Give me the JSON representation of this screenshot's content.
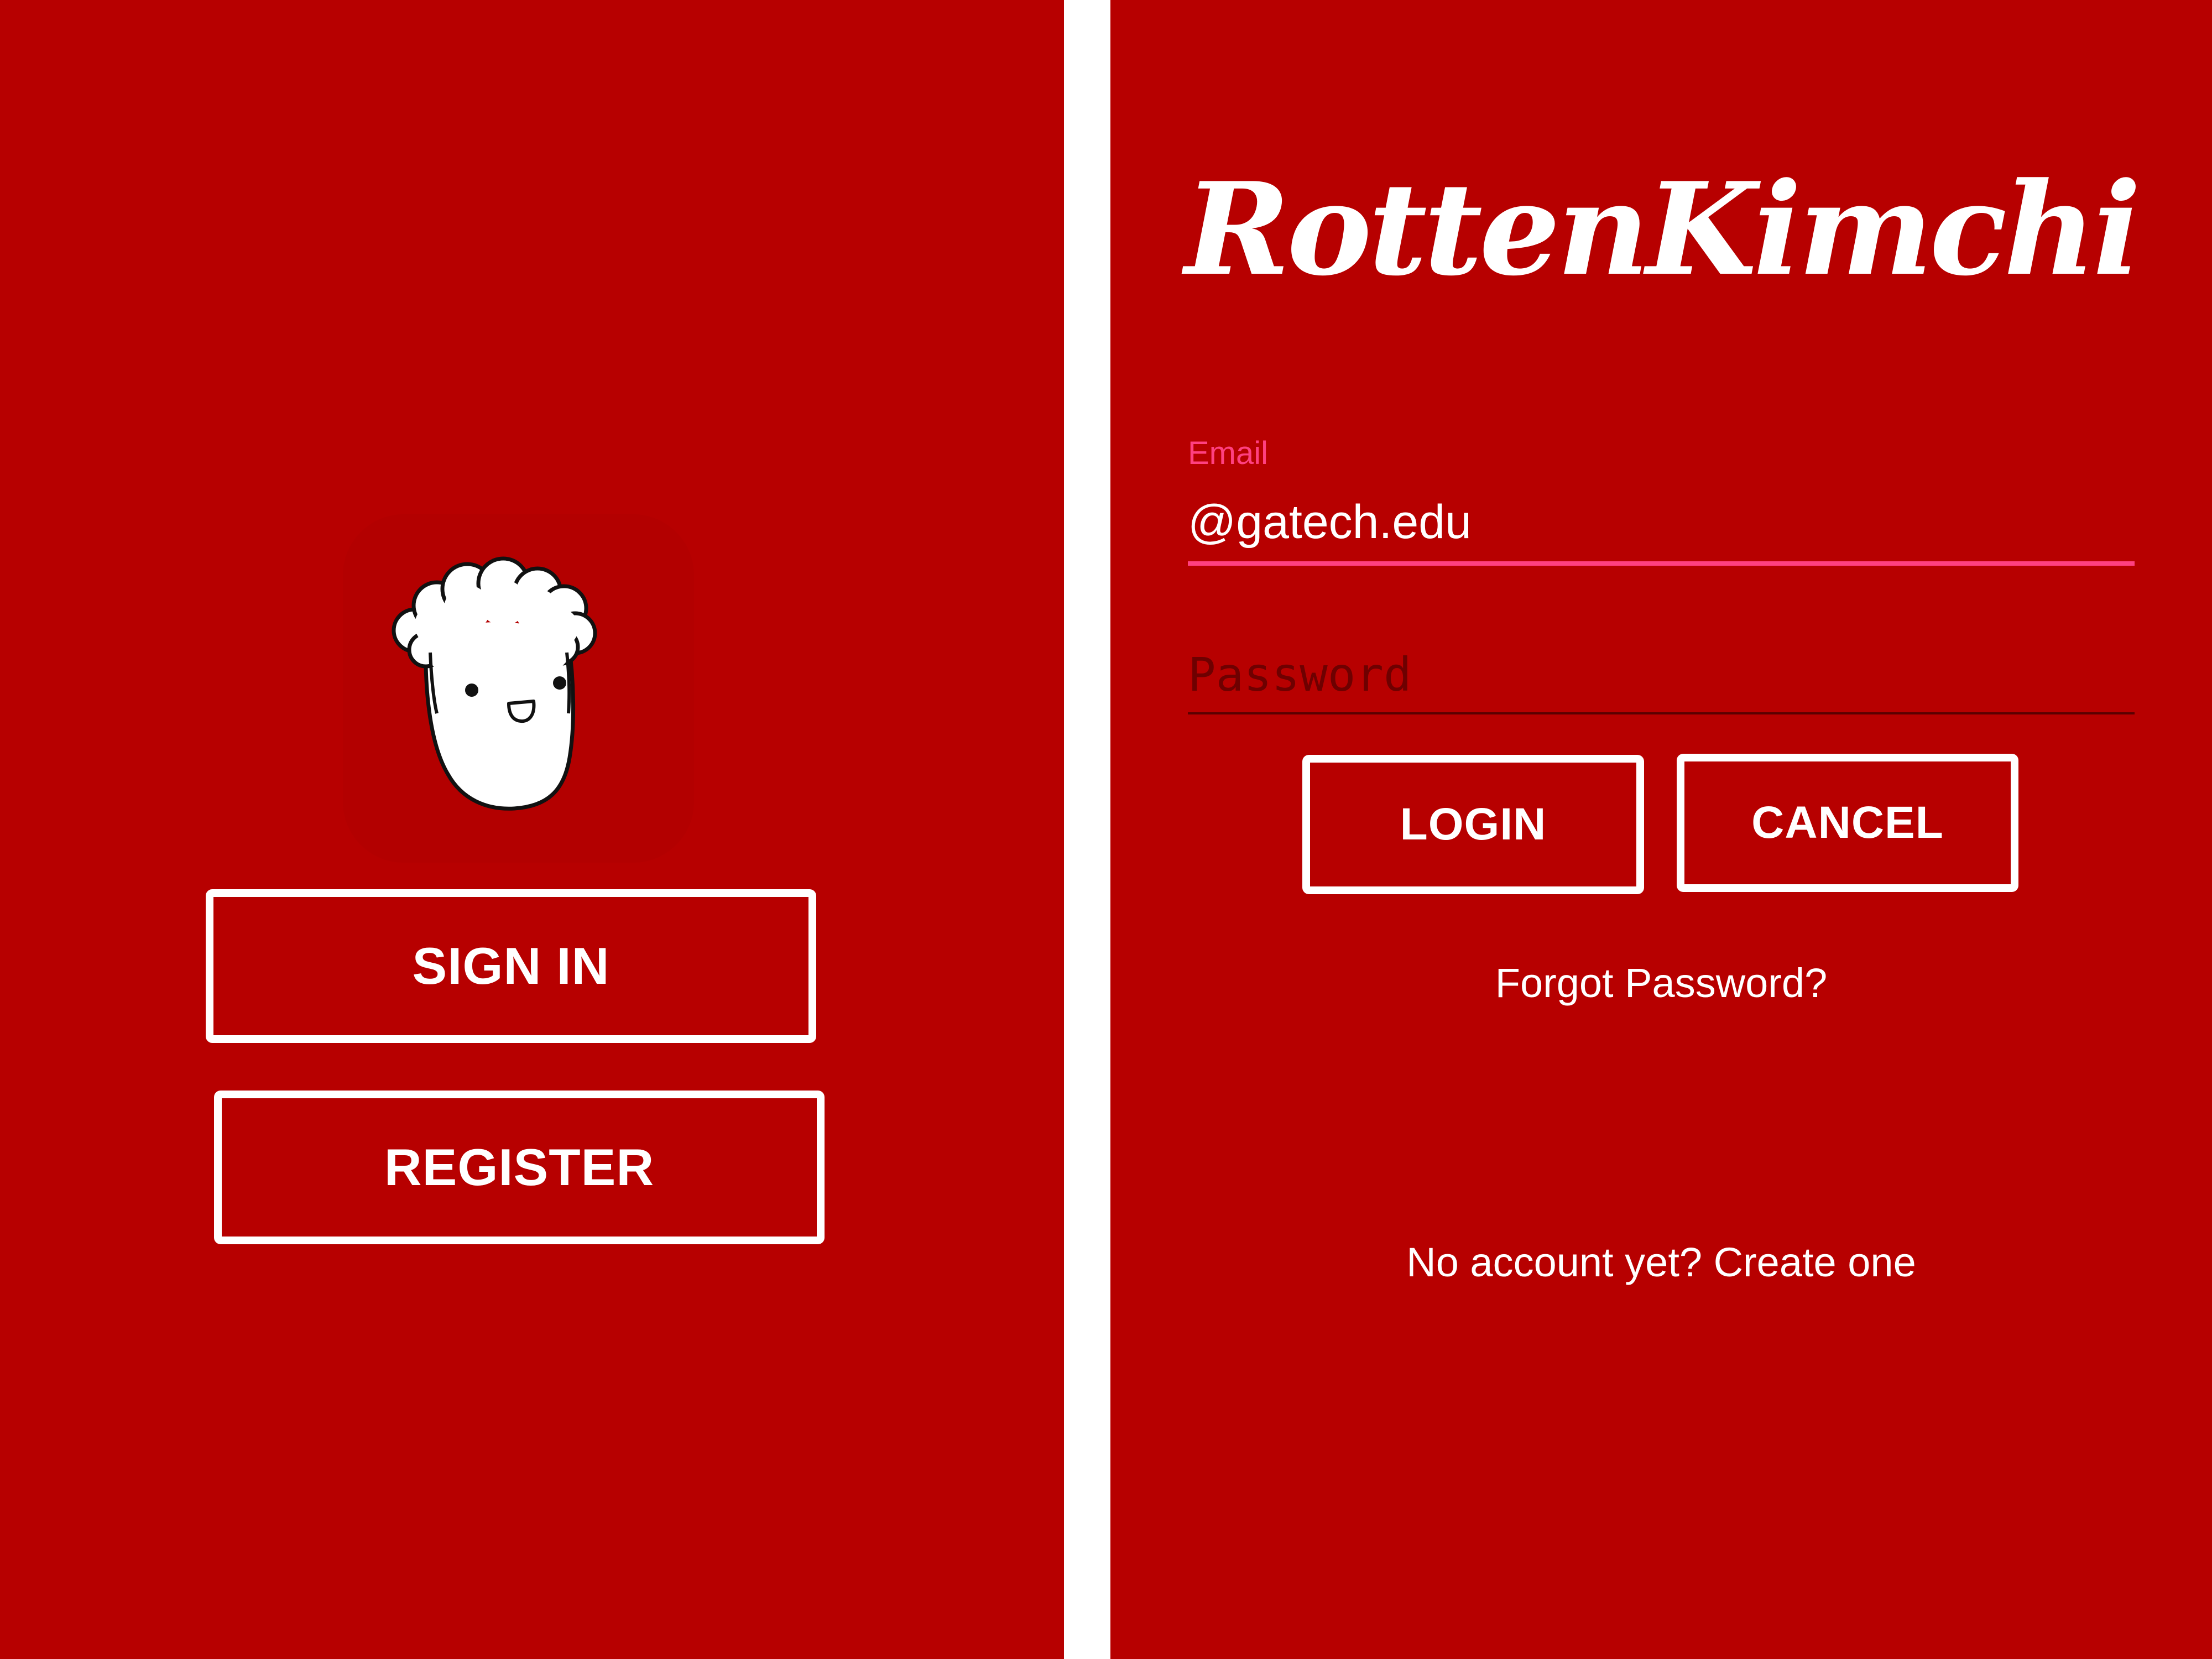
{
  "left_screen": {
    "logo_icon": "kimchi-mascot-icon",
    "sign_in_label": "SIGN IN",
    "register_label": "REGISTER"
  },
  "right_screen": {
    "brand_title": "RottenKimchi",
    "email": {
      "label": "Email",
      "value": "@gatech.edu"
    },
    "password": {
      "placeholder": "Password"
    },
    "login_label": "LOGIN",
    "cancel_label": "CANCEL",
    "forgot_password": "Forgot Password?",
    "create_account": "No account yet? Create one"
  },
  "colors": {
    "background": "#b70000",
    "accent": "#ff4081",
    "text": "#ffffff"
  }
}
